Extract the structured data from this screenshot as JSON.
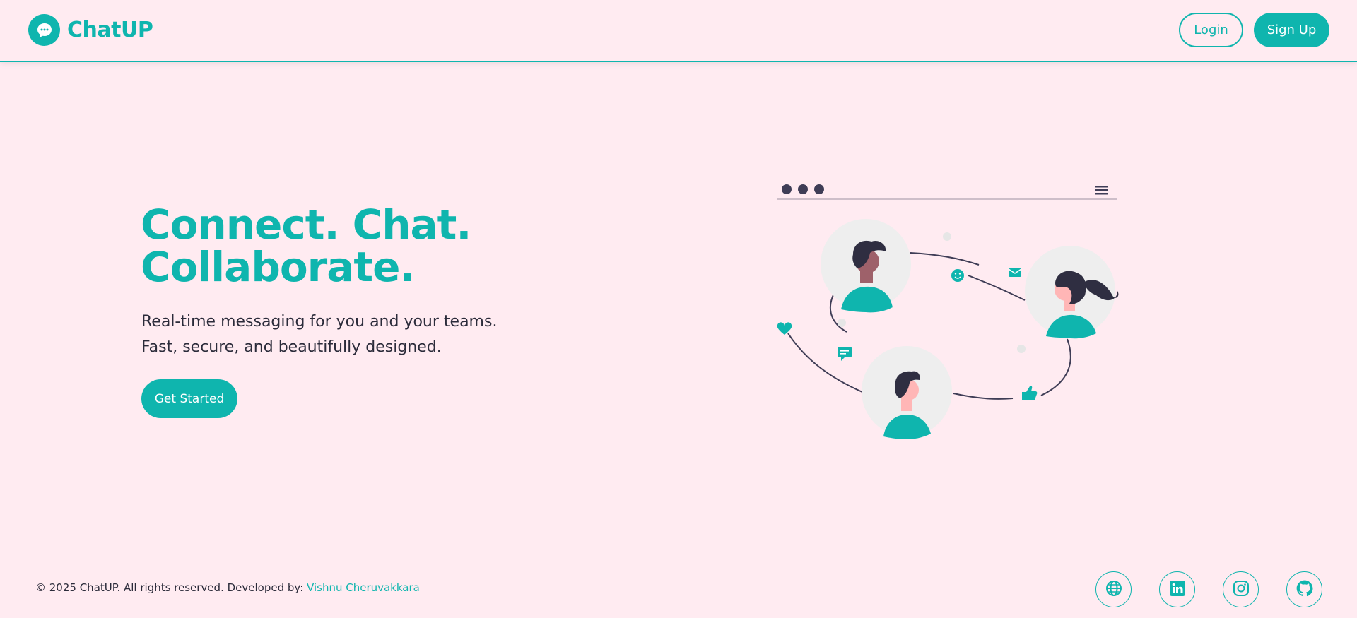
{
  "brand": {
    "name": "ChatUP",
    "icon": "chat-bubble-icon"
  },
  "nav": {
    "login_label": "Login",
    "signup_label": "Sign Up"
  },
  "hero": {
    "title_line1": "Connect. Chat.",
    "title_line2": "Collaborate.",
    "subtitle": "Real-time messaging for you and your teams. Fast, secure, and beautifully designed.",
    "cta_label": "Get Started"
  },
  "footer": {
    "copyright": "© 2025 ChatUP. All rights reserved. Developed by:",
    "developer": "Vishnu Cheruvakkara",
    "social_icons": [
      "globe-icon",
      "linkedin-icon",
      "instagram-icon",
      "github-icon"
    ]
  },
  "colors": {
    "accent": "#0fb5ae",
    "background": "#ffebf1",
    "text": "#2b2b3a"
  }
}
